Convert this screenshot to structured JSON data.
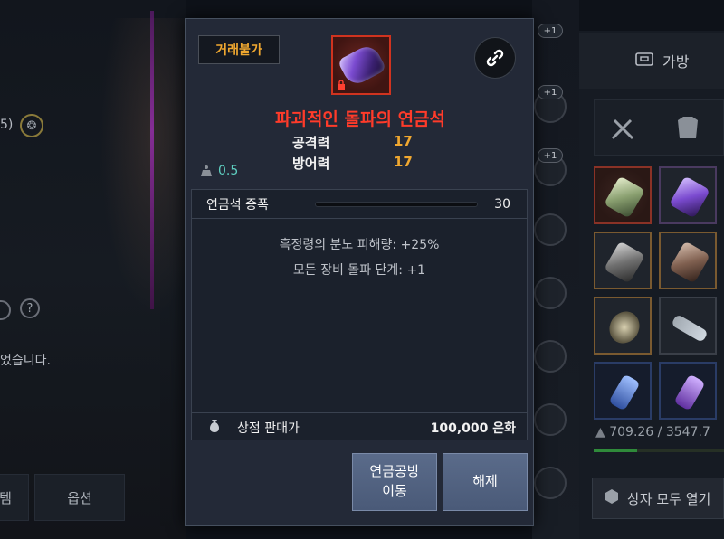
{
  "background": {
    "left_text_1": "5)",
    "left_text_2": "었습니다.",
    "left_help_icon": "?",
    "bottom_left_button": "템",
    "bottom_options_button": "옵션",
    "strip_badges": [
      "+1",
      "+1",
      "+1"
    ],
    "bag_tab_label": "가방",
    "weight_text": "709.26 / 3547.7",
    "open_all_button": "상자 모두 열기"
  },
  "tooltip": {
    "trade_badge": "거래불가",
    "item_name": "파괴적인 돌파의 연금석",
    "stats": [
      {
        "label": "공격력",
        "value": "17"
      },
      {
        "label": "방어력",
        "value": "17"
      }
    ],
    "weight": "0.5",
    "amplification": {
      "label": "연금석 증폭",
      "value": "30",
      "level": 0
    },
    "effects": [
      "흑정령의 분노 피해량: +25%",
      "모든 장비 돌파 단계: +1"
    ],
    "sale": {
      "label": "상점 판매가",
      "value": "100,000 은화"
    },
    "buttons": {
      "move": "연금공방\n이동",
      "release": "해제"
    }
  },
  "colors": {
    "item_name": "#ff3b2a",
    "stat_value": "#f0a830",
    "weight": "#5fd0c2",
    "trade_badge": "#f0a830"
  }
}
